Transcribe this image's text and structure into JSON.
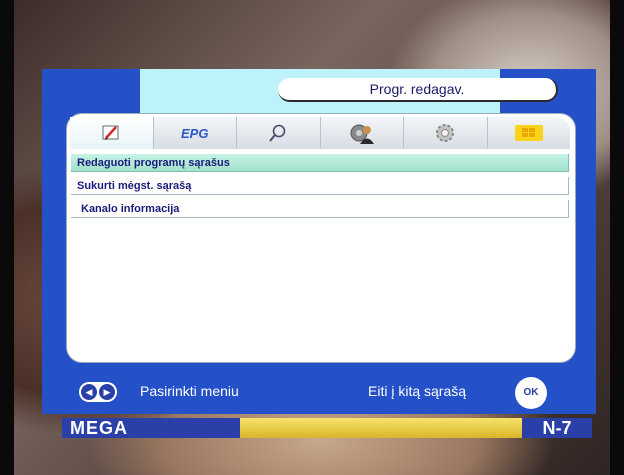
{
  "background": {
    "ticker_left": "MEGA",
    "ticker_right": "N-7"
  },
  "menu": {
    "title": "Progr. redagav.",
    "tabs": [
      {
        "icon": "pencil-icon",
        "selected": true
      },
      {
        "icon": "epg-icon",
        "label": "EPG",
        "selected": false
      },
      {
        "icon": "magnifier-icon",
        "selected": false
      },
      {
        "icon": "user-settings-icon",
        "selected": false
      },
      {
        "icon": "gear-icon",
        "selected": false
      },
      {
        "icon": "smartcard-icon",
        "selected": false
      }
    ],
    "items": [
      {
        "label": "Redaguoti programų sąrašus",
        "selected": true
      },
      {
        "label": "Sukurti mėgst. sąrašą",
        "selected": false
      },
      {
        "label": "Kanalo informacija",
        "selected": false
      }
    ]
  },
  "footer": {
    "left_hint": "Pasirinkti meniu",
    "right_hint": "Eiti į kitą sąrašą",
    "ok_label": "OK"
  },
  "colors": {
    "frame": "#2450c8",
    "header_band": "#bdf2fb",
    "selected_row": "#a2e2cc",
    "text_dark_blue": "#1a1a7a"
  }
}
